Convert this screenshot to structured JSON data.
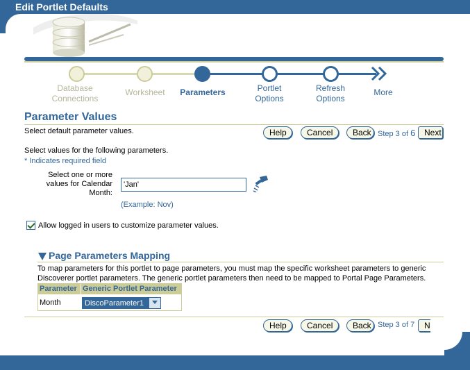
{
  "window": {
    "title": "Edit Portlet Defaults"
  },
  "train": {
    "steps": [
      {
        "label": "Database Connections",
        "state": "visited"
      },
      {
        "label": "Worksheet",
        "state": "visited"
      },
      {
        "label": "Parameters",
        "state": "current"
      },
      {
        "label": "Portlet Options",
        "state": "todo"
      },
      {
        "label": "Refresh Options",
        "state": "todo"
      }
    ],
    "more_label": "More"
  },
  "section": {
    "title": "Parameter Values",
    "instruction": "Select default parameter values.",
    "sub_instruction": "Select values for the following parameters.",
    "required_note": "* Indicates required field"
  },
  "nav_top": {
    "help": "Help",
    "cancel": "Cancel",
    "back": "Back",
    "next": "Next",
    "step_prefix": "Step 3 of ",
    "step_total": "6"
  },
  "param": {
    "label": "Select one or more values for Calendar Month:",
    "value": "'Jan'",
    "example": "(Example: Nov)"
  },
  "customize": {
    "checked": true,
    "label": "Allow logged in users to customize parameter values."
  },
  "mapping": {
    "title": "Page Parameters Mapping",
    "description": "To map parameters for this portlet to page parameters, you must map the specific worksheet parameters to generic Discoverer portlet parameters. The generic portlet parameters then need to be mapped to Portal Page Parameters.",
    "columns": [
      "Parameter",
      "Generic Portlet Parameter"
    ],
    "rows": [
      {
        "parameter": "Month",
        "generic": "DiscoParameter1"
      }
    ]
  },
  "nav_bottom": {
    "help": "Help",
    "cancel": "Cancel",
    "back": "Back",
    "next": "Next",
    "step": "Step 3 of 7"
  },
  "colors": {
    "brand": "#336699",
    "accent": "#cccc99"
  }
}
